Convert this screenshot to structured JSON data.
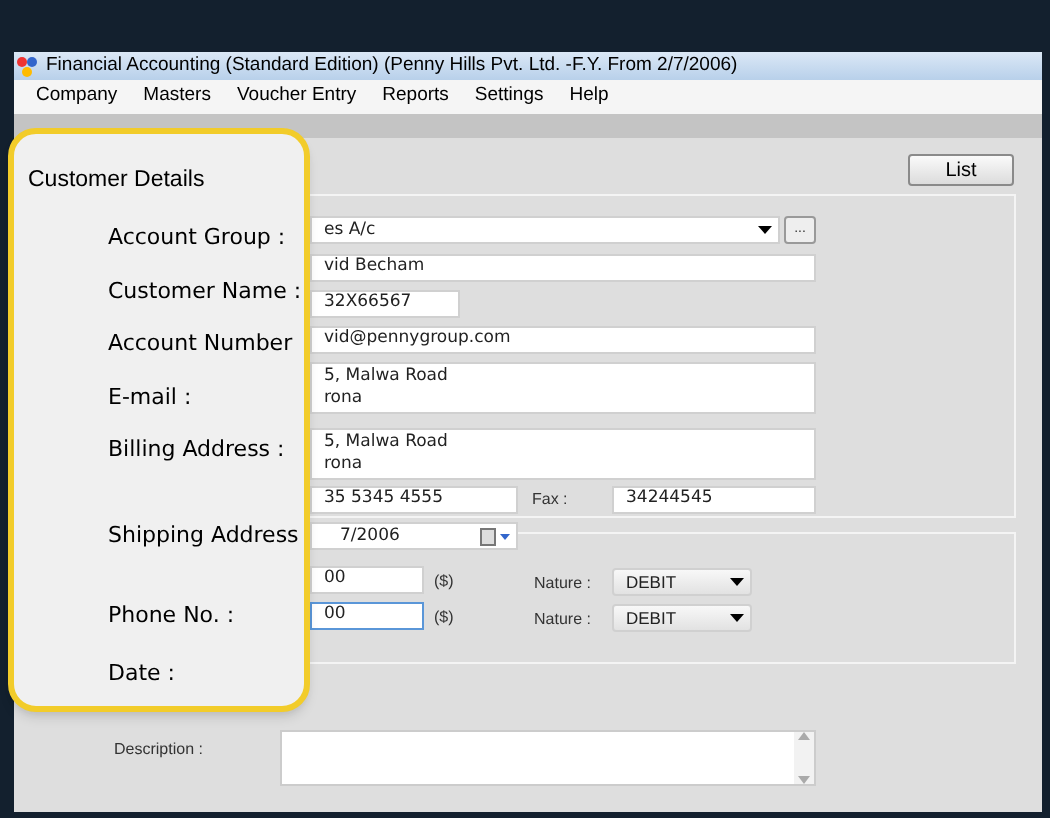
{
  "window": {
    "title": "Financial Accounting (Standard Edition) (Penny Hills Pvt. Ltd. -F.Y. From 2/7/2006)"
  },
  "menu": [
    "Company",
    "Masters",
    "Voucher Entry",
    "Reports",
    "Settings",
    "Help"
  ],
  "list_button": "List",
  "form": {
    "account_group": "es A/c",
    "ellipsis": "...",
    "customer_name": "vid Becham",
    "account_number": "32X66567",
    "email": "vid@pennygroup.com",
    "billing_address": [
      "5, Malwa Road",
      "rona"
    ],
    "shipping_address": [
      "5, Malwa Road",
      "rona"
    ],
    "phone": "35 5345 4555",
    "fax_label": "Fax :",
    "fax": "34244545",
    "date": "7/2006"
  },
  "balances": [
    {
      "amount": "00",
      "unit": "($)",
      "nature_label": "Nature :",
      "nature": "DEBIT",
      "focused": false
    },
    {
      "amount": "00",
      "unit": "($)",
      "nature_label": "Nature :",
      "nature": "DEBIT",
      "focused": true
    }
  ],
  "description_label": "Description :",
  "callout": {
    "title": "Customer Details",
    "labels": [
      "Account Group :",
      "Customer Name :",
      "Account Number",
      "E-mail :",
      "Billing Address :",
      "Shipping Address",
      "Phone No. :",
      "Date :"
    ]
  }
}
